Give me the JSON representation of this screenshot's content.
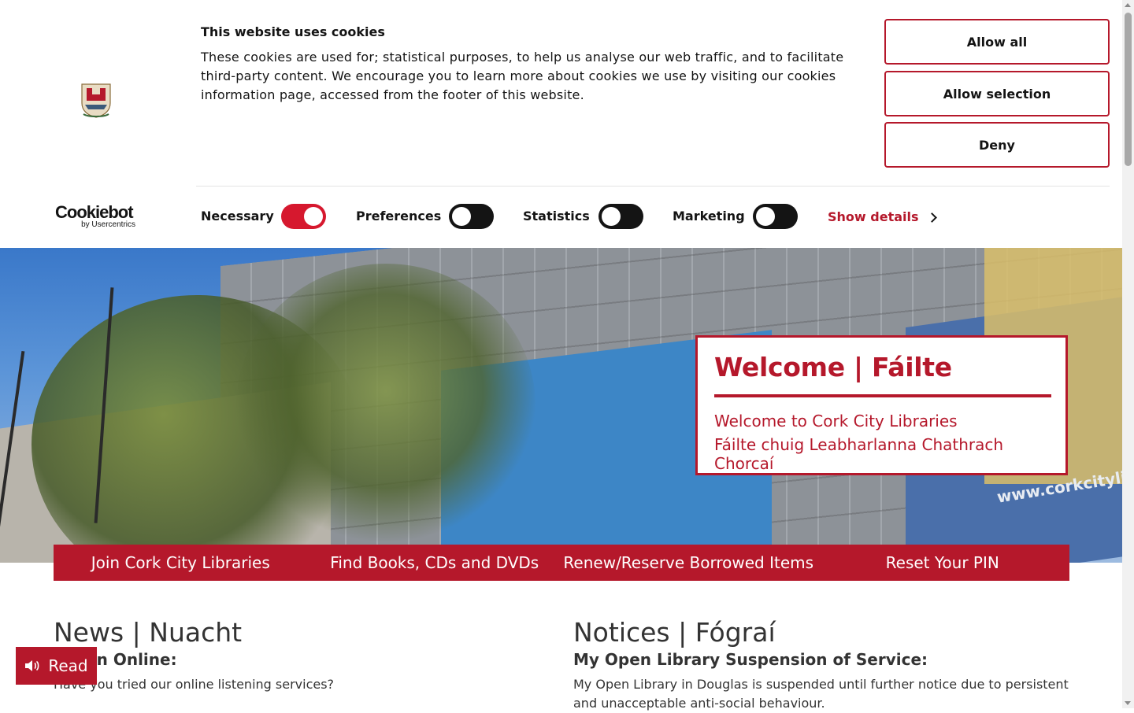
{
  "cookie_banner": {
    "title": "This website uses cookies",
    "text": "These cookies are used for; statistical purposes, to help us analyse our web traffic, and to facilitate third-party content. We encourage you to learn more about cookies we use by visiting our cookies information page, accessed from the footer of this website.",
    "buttons": {
      "allow_all": "Allow all",
      "allow_selection": "Allow selection",
      "deny": "Deny"
    },
    "logo": {
      "word": "Cookiebot",
      "sub": "by Usercentrics"
    },
    "toggles": [
      {
        "label": "Necessary",
        "on": true
      },
      {
        "label": "Preferences",
        "on": false
      },
      {
        "label": "Statistics",
        "on": false
      },
      {
        "label": "Marketing",
        "on": false
      }
    ],
    "show_details": "Show details"
  },
  "hero": {
    "welcome_title": "Welcome | Fáilte",
    "welcome_en": "Welcome to Cork City Libraries",
    "welcome_ga": "Fáilte chuig Leabharlanna Chathrach Chorcaí",
    "banner_url": "www.corkcitylibr"
  },
  "quick_links": [
    "Join Cork City Libraries",
    "Find Books, CDs and DVDs",
    "Renew/Reserve Borrowed Items",
    "Reset Your PIN"
  ],
  "news": {
    "title": "News | Nuacht",
    "item_title": "Listen Online:",
    "item_text": "Have you tried our online listening services?"
  },
  "notices": {
    "title": "Notices | Fógraí",
    "item_title": "My Open Library Suspension of Service:",
    "item_text": "My Open Library in Douglas is suspended until further notice due to persistent and unacceptable anti-social behaviour."
  },
  "read_button": "Read",
  "colors": {
    "brand_red": "#b5182b",
    "toggle_on": "#d6182e",
    "toggle_off": "#141414"
  }
}
